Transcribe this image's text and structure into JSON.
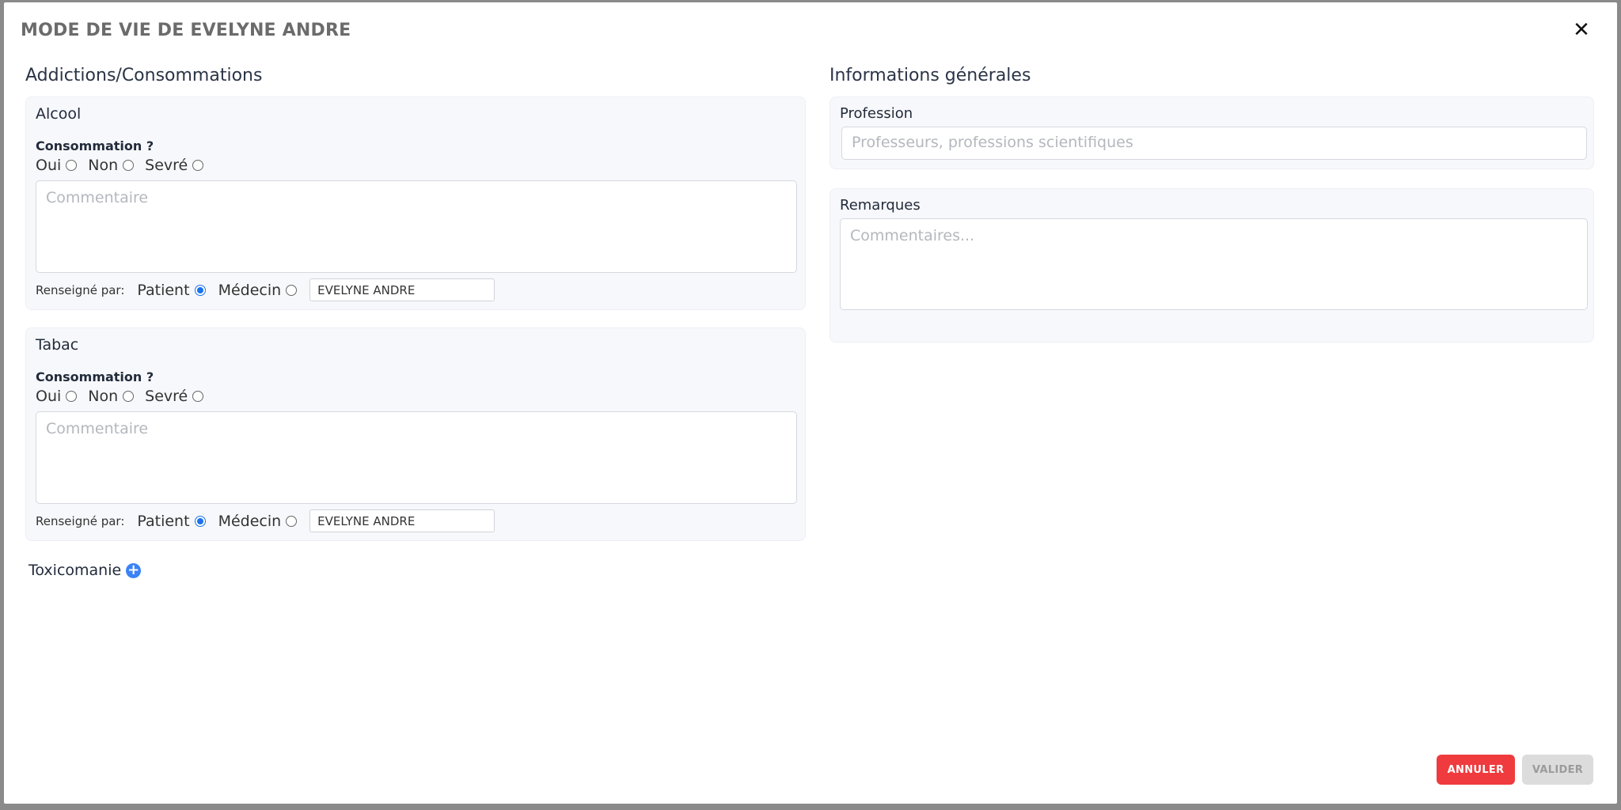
{
  "modal": {
    "title": "MODE DE VIE DE EVELYNE ANDRE",
    "close_symbol": "✕"
  },
  "left": {
    "title": "Addictions/Consommations",
    "alcool": {
      "title": "Alcool",
      "question": "Consommation ?",
      "options": [
        "Oui",
        "Non",
        "Sevré"
      ],
      "comment_placeholder": "Commentaire",
      "renseigne_label": "Renseigné par:",
      "by_options": [
        "Patient",
        "Médecin"
      ],
      "selected_by": "Patient",
      "name_value": "EVELYNE ANDRE"
    },
    "tabac": {
      "title": "Tabac",
      "question": "Consommation ?",
      "options": [
        "Oui",
        "Non",
        "Sevré"
      ],
      "comment_placeholder": "Commentaire",
      "renseigne_label": "Renseigné par:",
      "by_options": [
        "Patient",
        "Médecin"
      ],
      "selected_by": "Patient",
      "name_value": "EVELYNE ANDRE"
    },
    "toxicomanie": "Toxicomanie"
  },
  "right": {
    "title": "Informations générales",
    "profession_label": "Profession",
    "profession_placeholder": "Professeurs, professions scientifiques",
    "remarques_label": "Remarques",
    "remarques_placeholder": "Commentaires..."
  },
  "footer": {
    "cancel_label": "ANNULER",
    "validate_label": "VALIDER"
  },
  "colors": {
    "accent": "#1a73e8",
    "cancel": "#ef3b3e",
    "disabled": "#dcdcdc"
  },
  "icons": {
    "close": "close-icon",
    "add": "plus-circle-icon"
  }
}
